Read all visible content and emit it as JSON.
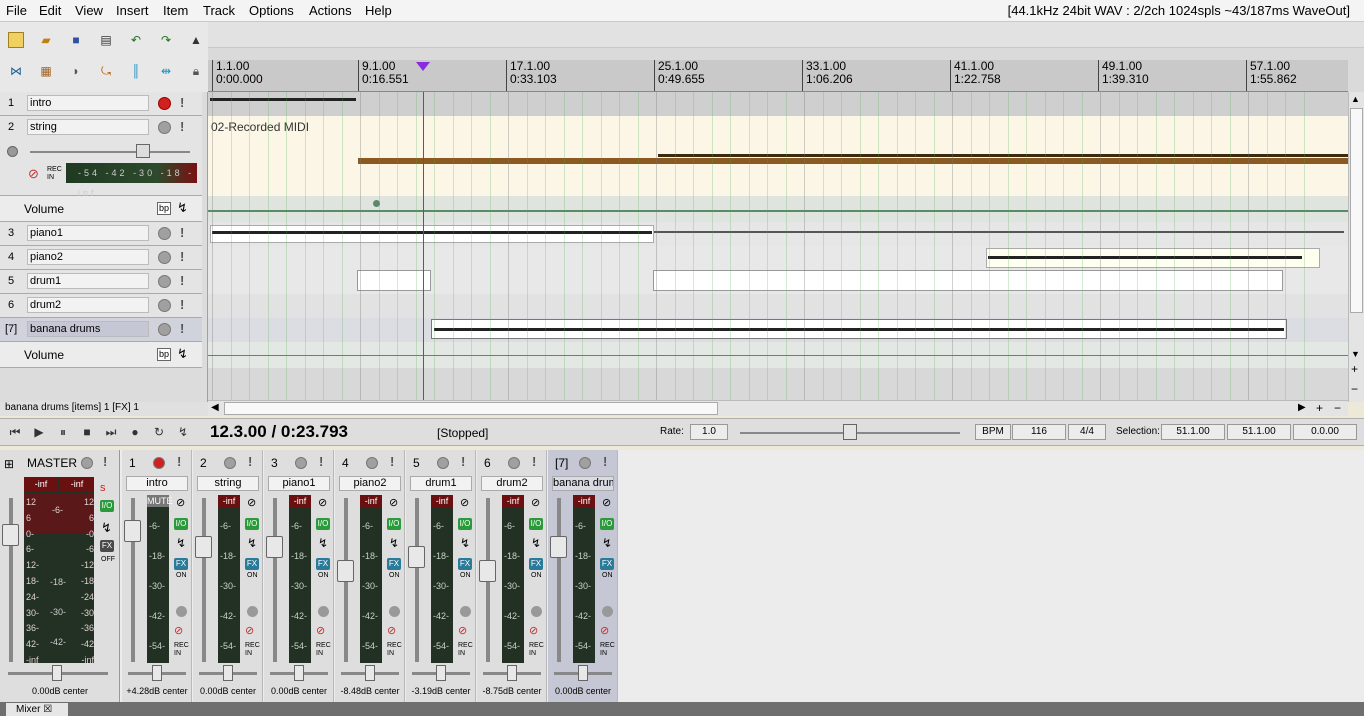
{
  "menu": [
    "File",
    "Edit",
    "View",
    "Insert",
    "Item",
    "Track",
    "Options",
    "Actions",
    "Help"
  ],
  "audio_status": "[44.1kHz 24bit WAV : 2/2ch 1024spls ~43/187ms WaveOut]",
  "ruler": [
    {
      "bar": "1.1.00",
      "time": "0:00.000"
    },
    {
      "bar": "9.1.00",
      "time": "0:16.551"
    },
    {
      "bar": "17.1.00",
      "time": "0:33.103"
    },
    {
      "bar": "25.1.00",
      "time": "0:49.655"
    },
    {
      "bar": "33.1.00",
      "time": "1:06.206"
    },
    {
      "bar": "41.1.00",
      "time": "1:22.758"
    },
    {
      "bar": "49.1.00",
      "time": "1:39.310"
    },
    {
      "bar": "57.1.00",
      "time": "1:55.862"
    }
  ],
  "tracks": [
    {
      "num": "1",
      "name": "intro"
    },
    {
      "num": "2",
      "name": "string"
    },
    {
      "num": "3",
      "name": "piano1"
    },
    {
      "num": "4",
      "name": "piano2"
    },
    {
      "num": "5",
      "name": "drum1"
    },
    {
      "num": "6",
      "name": "drum2"
    },
    {
      "num": "[7]",
      "name": "banana drums"
    }
  ],
  "string_meter_ticks": [
    "-54",
    "-42",
    "-30",
    "-18",
    "-inf"
  ],
  "rec_in": "REC IN",
  "envelope": {
    "label": "Volume",
    "bp": "bp"
  },
  "midi_item_label": "02-Recorded MIDI",
  "track_status": "banana drums [items] 1 [FX] 1",
  "transport": {
    "time": "12.3.00 / 0:23.793",
    "state": "[Stopped]",
    "rate_label": "Rate:",
    "rate": "1.0",
    "bpm_label": "BPM",
    "bpm": "116",
    "timesig": "4/4",
    "selection_label": "Selection:",
    "sel_start": "51.1.00",
    "sel_end": "51.1.00",
    "sel_len": "0.0.00"
  },
  "mixer": {
    "master": {
      "name": "MASTER",
      "db": "0.00dB center",
      "left": "-inf",
      "right": "-inf",
      "mid": "-6-",
      "off": "OFF",
      "s": "S"
    },
    "master_scale": [
      "12",
      "6",
      "0-",
      "6-",
      "12-",
      "18-",
      "24-",
      "30-",
      "36-",
      "42-",
      "-inf"
    ],
    "master_scale_right": [
      "12",
      "6",
      "-0",
      "-6",
      "-12",
      "-18",
      "-24",
      "-30",
      "-36",
      "-42",
      "-inf"
    ],
    "master_mid": [
      "-18-",
      "-30-",
      "-42-",
      "-54-"
    ],
    "strips": [
      {
        "num": "1",
        "name": "intro",
        "db": "+4.28dB center",
        "top": "MUTE",
        "red": true
      },
      {
        "num": "2",
        "name": "string",
        "db": "0.00dB center",
        "top": "-inf"
      },
      {
        "num": "3",
        "name": "piano1",
        "db": "0.00dB center",
        "top": "-inf"
      },
      {
        "num": "4",
        "name": "piano2",
        "db": "-8.48dB center",
        "top": "-inf"
      },
      {
        "num": "5",
        "name": "drum1",
        "db": "-3.19dB center",
        "top": "-inf"
      },
      {
        "num": "6",
        "name": "drum2",
        "db": "-8.75dB center",
        "top": "-inf"
      },
      {
        "num": "[7]",
        "name": "banana drum",
        "db": "0.00dB center",
        "top": "-inf",
        "sel": true
      }
    ],
    "strip_ticks": [
      "-6-",
      "-18-",
      "-30-",
      "-42-",
      "-54-"
    ],
    "on": "ON",
    "io": "I/O",
    "fx": "FX",
    "rec_in": "REC IN"
  },
  "tab": {
    "label": "Mixer",
    "close": "☒"
  },
  "colors": {
    "ruler": "#c9c9c9",
    "playhead": "#8a2be2",
    "meter_top": "#6a1010",
    "strip_selected": "#c5c7d4"
  },
  "icons": [
    "new-project-icon",
    "open-icon",
    "save-icon",
    "project-settings-icon",
    "undo-icon",
    "redo-icon",
    "metronome-icon",
    "snap-icon",
    "grid-icon",
    "ripple-icon",
    "lock-icon",
    "play-icon",
    "stop-icon",
    "pause-icon",
    "record-icon",
    "loop-icon"
  ]
}
